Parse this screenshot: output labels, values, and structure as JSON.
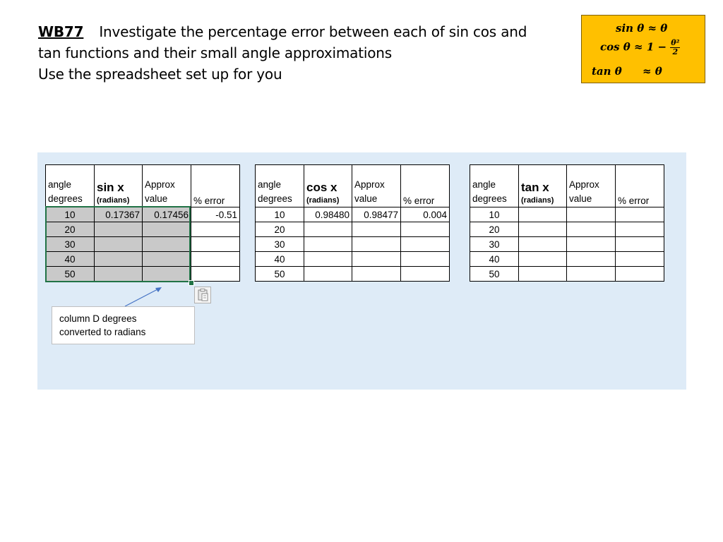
{
  "title": {
    "code": "WB77",
    "line1": "Investigate the percentage error between each of sin cos and",
    "line2": "tan functions and their small angle approximations",
    "line3": "Use the spreadsheet set up for you"
  },
  "formulas": {
    "sin_lhs": "sin θ ≈ θ",
    "cos_lhs": "cos θ ≈ 1 −",
    "cos_num": "θ²",
    "cos_den": "2",
    "tan_lhs": "tan θ",
    "tan_rhs": "≈ θ"
  },
  "tables": {
    "sin": {
      "h_angle1": "angle",
      "h_angle2": "degrees",
      "h_fn": "sin x",
      "h_fn_sub": "(radians)",
      "h_approx1": "Approx",
      "h_approx2": "value",
      "h_err": "% error",
      "rows": [
        {
          "deg": "10",
          "fn": "0.17367",
          "approx": "0.17456",
          "err": "-0.51"
        },
        {
          "deg": "20",
          "fn": "",
          "approx": "",
          "err": ""
        },
        {
          "deg": "30",
          "fn": "",
          "approx": "",
          "err": ""
        },
        {
          "deg": "40",
          "fn": "",
          "approx": "",
          "err": ""
        },
        {
          "deg": "50",
          "fn": "",
          "approx": "",
          "err": ""
        }
      ]
    },
    "cos": {
      "h_angle1": "angle",
      "h_angle2": "degrees",
      "h_fn": "cos x",
      "h_fn_sub": "(radians)",
      "h_approx1": "Approx",
      "h_approx2": "value",
      "h_err": "% error",
      "rows": [
        {
          "deg": "10",
          "fn": "0.98480",
          "approx": "0.98477",
          "err": "0.004"
        },
        {
          "deg": "20",
          "fn": "",
          "approx": "",
          "err": ""
        },
        {
          "deg": "30",
          "fn": "",
          "approx": "",
          "err": ""
        },
        {
          "deg": "40",
          "fn": "",
          "approx": "",
          "err": ""
        },
        {
          "deg": "50",
          "fn": "",
          "approx": "",
          "err": ""
        }
      ]
    },
    "tan": {
      "h_angle1": "angle",
      "h_angle2": "degrees",
      "h_fn": "tan x",
      "h_fn_sub": "(radians)",
      "h_approx1": "Approx",
      "h_approx2": "value",
      "h_err": "% error",
      "rows": [
        {
          "deg": "10",
          "fn": "",
          "approx": "",
          "err": ""
        },
        {
          "deg": "20",
          "fn": "",
          "approx": "",
          "err": ""
        },
        {
          "deg": "30",
          "fn": "",
          "approx": "",
          "err": ""
        },
        {
          "deg": "40",
          "fn": "",
          "approx": "",
          "err": ""
        },
        {
          "deg": "50",
          "fn": "",
          "approx": "",
          "err": ""
        }
      ]
    }
  },
  "callout": {
    "line1": "column D degrees",
    "line2": "converted to radians"
  },
  "colors": {
    "formula_box": "#ffc000",
    "panel": "#deebf7",
    "shaded_cell": "#c9c9c9",
    "selection": "#217346",
    "arrow": "#4472c4"
  },
  "icons": [
    "paste-options-icon"
  ]
}
